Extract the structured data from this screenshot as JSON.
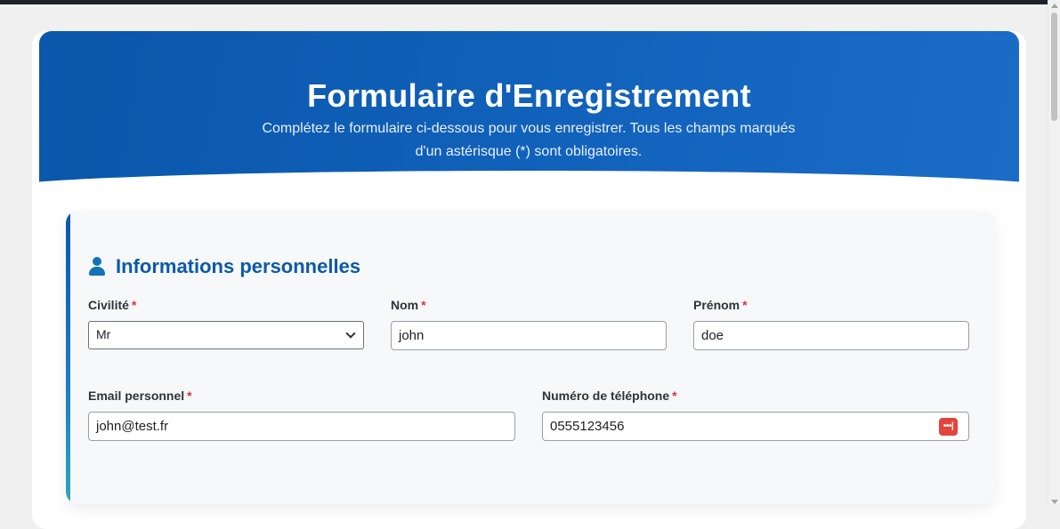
{
  "header": {
    "title": "Formulaire d'Enregistrement",
    "subtitle": "Complétez le formulaire ci-dessous pour vous enregistrer. Tous les champs marqués d'un astérisque (*) sont obligatoires."
  },
  "section": {
    "icon": "user-icon",
    "title": "Informations personnelles"
  },
  "fields": {
    "civilite": {
      "label": "Civilité",
      "required_mark": "*",
      "value": "Mr"
    },
    "nom": {
      "label": "Nom",
      "required_mark": "*",
      "value": "john"
    },
    "prenom": {
      "label": "Prénom",
      "required_mark": "*",
      "value": "doe"
    },
    "email": {
      "label": "Email personnel",
      "required_mark": "*",
      "value": "john@test.fr"
    },
    "telephone": {
      "label": "Numéro de téléphone",
      "required_mark": "*",
      "value": "0555123456",
      "icon": "password-manager-icon",
      "icon_text": "•••|"
    }
  },
  "colors": {
    "header_bg": "#0a57ab",
    "section_title": "#0c5aa6",
    "required": "#d9363e",
    "password_icon": "#e2453c"
  }
}
